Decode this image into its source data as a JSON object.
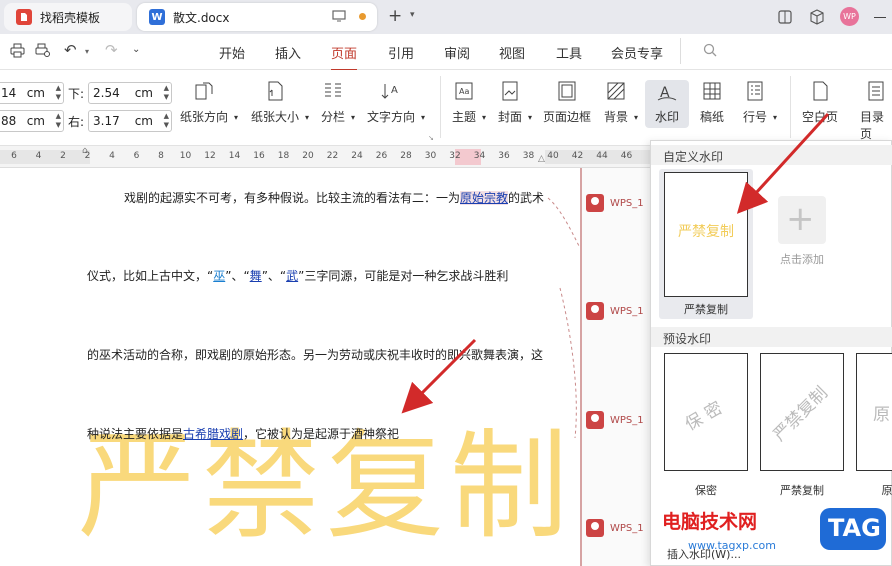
{
  "tabs": [
    {
      "label": "找稻壳模板",
      "icon": "docer-icon"
    },
    {
      "label": "散文.docx",
      "icon": "word-doc-icon",
      "icon_letter": "W"
    }
  ],
  "user_avatar_text": "WP",
  "menu": [
    "开始",
    "插入",
    "页面",
    "引用",
    "审阅",
    "视图",
    "工具",
    "会员专享"
  ],
  "active_menu": "页面",
  "margins": {
    "top_value": "14",
    "bottom_label": "下:",
    "bottom_value": "2.54",
    "left_value": "88",
    "right_label": "右:",
    "right_value": "3.17",
    "unit": "cm"
  },
  "ribbon": [
    {
      "label": "纸张方向",
      "icon": "orientation-icon"
    },
    {
      "label": "纸张大小",
      "icon": "paper-size-icon"
    },
    {
      "label": "分栏",
      "icon": "columns-icon"
    },
    {
      "label": "文字方向",
      "icon": "text-direction-icon"
    },
    {
      "label": "主题",
      "icon": "theme-icon"
    },
    {
      "label": "封面",
      "icon": "cover-icon"
    },
    {
      "label": "页面边框",
      "icon": "page-border-icon"
    },
    {
      "label": "背景",
      "icon": "background-icon"
    },
    {
      "label": "水印",
      "icon": "watermark-icon"
    },
    {
      "label": "稿纸",
      "icon": "manuscript-icon"
    },
    {
      "label": "行号",
      "icon": "line-number-icon"
    },
    {
      "label": "空白页",
      "icon": "blank-page-icon"
    },
    {
      "label": "目录页",
      "icon": "toc-page-icon"
    }
  ],
  "ruler_numbers": [
    "6",
    "4",
    "2",
    "2",
    "4",
    "6",
    "8",
    "10",
    "12",
    "14",
    "16",
    "18",
    "20",
    "22",
    "24",
    "26",
    "28",
    "30",
    "32",
    "34",
    "36",
    "38",
    "40",
    "42",
    "44",
    "46"
  ],
  "document": {
    "line1": {
      "pre": "戏剧的起源实不可考，有多种假说。比较主流的看法有二：一为",
      "link": "原始宗教",
      "post": "的武术"
    },
    "line2": {
      "p1": "仪式，比如上古中文，“",
      "w1": "巫",
      "p2": "”、“",
      "w2": "舞",
      "p3": "”、“",
      "w3": "武",
      "p4": "”三字同源，可能是对一种乞求战斗胜利"
    },
    "line3": "的巫术活动的合称，即戏剧的原始形态。另一为劳动或庆祝丰收时的即兴歌舞表演，这",
    "line4": {
      "pre": "种说法主要依据是",
      "link": "古希腊戏剧",
      "post": "，它被认为是起源于酒神祭祀"
    },
    "watermark": "严禁复制"
  },
  "comments": [
    "WPS_1",
    "WPS_1",
    "WPS_1",
    "WPS_1"
  ],
  "watermark_panel": {
    "custom_title": "自定义水印",
    "custom_item": {
      "text": "严禁复制",
      "label": "严禁复制"
    },
    "add_label": "点击添加",
    "preset_title": "预设水印",
    "presets": [
      {
        "text": "保 密",
        "label": "保密"
      },
      {
        "text": "严禁复制",
        "label": "严禁复制"
      },
      {
        "text": "原",
        "label": "原"
      }
    ],
    "insert_label": "插入水印(W)..."
  },
  "banner": {
    "site": "电脑技术网",
    "tag": "TAG",
    "url": "www.tagxp.com"
  },
  "colors": {
    "accent": "#c0392b",
    "watermark": "#f9d97c",
    "arrow": "#d22a2a"
  }
}
